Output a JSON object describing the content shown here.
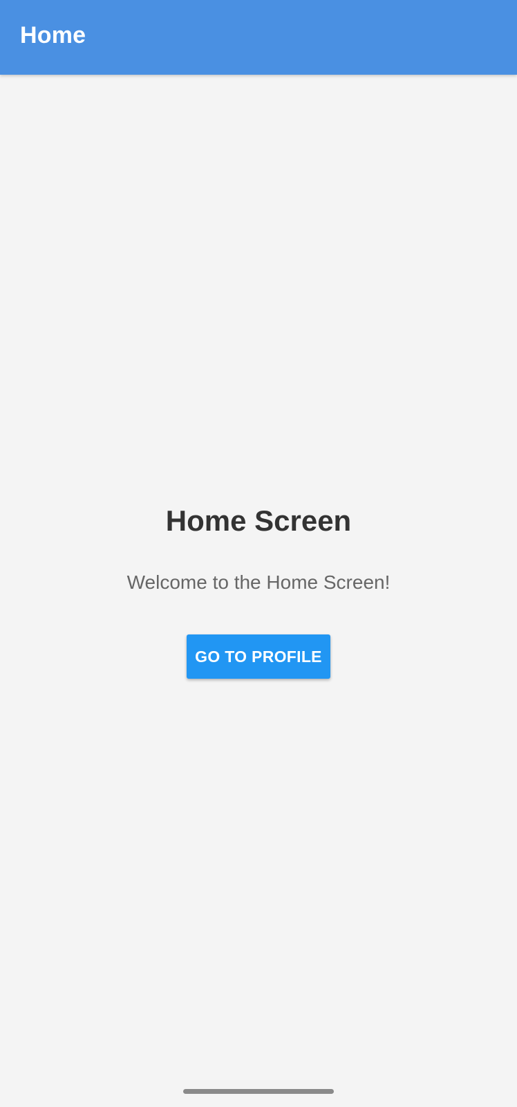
{
  "app_bar": {
    "title": "Home"
  },
  "main": {
    "title": "Home Screen",
    "subtitle": "Welcome to the Home Screen!",
    "button_label": "GO TO PROFILE"
  },
  "colors": {
    "app_bar_bg": "#4a90e2",
    "button_bg": "#2196f3",
    "background": "#f4f4f4",
    "title_text": "#333333",
    "subtitle_text": "#666666"
  }
}
